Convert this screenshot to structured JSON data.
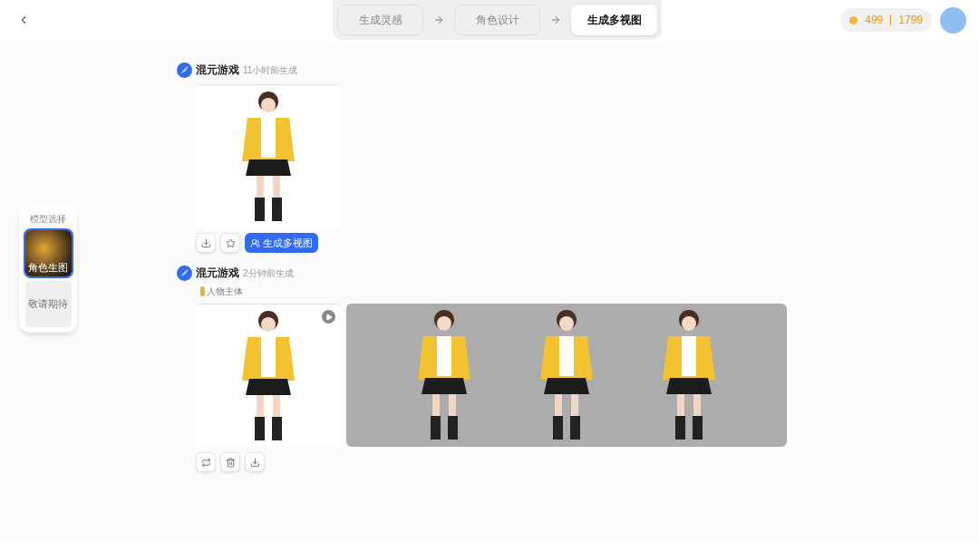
{
  "steps": [
    {
      "label": "生成灵感",
      "selected": false
    },
    {
      "label": "角色设计",
      "selected": false
    },
    {
      "label": "生成多视图",
      "selected": true
    }
  ],
  "credits": {
    "used": "499",
    "total": "1799"
  },
  "model_panel": {
    "title": "模型选择",
    "options": [
      {
        "label": "角色生图",
        "kind": "image",
        "selected": true
      },
      {
        "label": "敬请期待",
        "kind": "placeholder",
        "selected": false
      }
    ]
  },
  "posts": [
    {
      "author": "混元游戏",
      "time": "11小时前生成",
      "actions": [
        {
          "kind": "download"
        },
        {
          "kind": "star"
        },
        {
          "kind": "primary",
          "label": "生成多视图"
        }
      ]
    },
    {
      "author": "混元游戏",
      "time": "2分钟前生成",
      "tag": "人物主体",
      "multiview": true,
      "actions": [
        {
          "kind": "regenerate"
        },
        {
          "kind": "delete"
        },
        {
          "kind": "download"
        }
      ]
    }
  ]
}
